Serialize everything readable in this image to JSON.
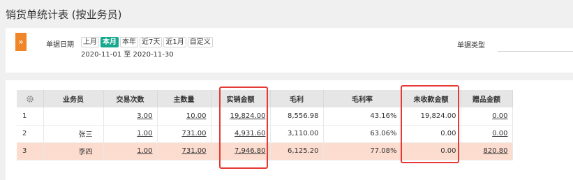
{
  "page": {
    "title": "销货单统计表 (按业务员)"
  },
  "filters": {
    "toggle_icon": "»",
    "date_label": "单据日期",
    "ranges": [
      "上月",
      "本月",
      "本年",
      "近7天",
      "近1月",
      "自定义"
    ],
    "active_range": "本月",
    "date_from": "2020-11-01",
    "date_sep": "至",
    "date_to": "2020-11-30",
    "doctype_label": "单据类型",
    "doctype_value": ""
  },
  "table": {
    "columns": [
      "",
      "业务员",
      "交易次数",
      "主数量",
      "实销金额",
      "毛利",
      "毛利率",
      "未收款金额",
      "赠品金额"
    ],
    "rows": [
      {
        "idx": "1",
        "name": "",
        "count": "3.00",
        "qty": "10.00",
        "sales": "19,824.00",
        "profit": "8,556.98",
        "margin": "43.16%",
        "unpaid": "19,824.00",
        "gift": "0.00"
      },
      {
        "idx": "2",
        "name": "张三",
        "count": "1.00",
        "qty": "731.00",
        "sales": "4,931.60",
        "profit": "3,110.00",
        "margin": "63.06%",
        "unpaid": "0.00",
        "gift": "0.00"
      },
      {
        "idx": "3",
        "name": "李四",
        "count": "1.00",
        "qty": "731.00",
        "sales": "7,946.80",
        "profit": "6,125.20",
        "margin": "77.08%",
        "unpaid": "0.00",
        "gift": "820.80"
      }
    ]
  },
  "colors": {
    "accent": "#18a88e",
    "toggle": "#f0862a",
    "highlight_box": "#e53935",
    "selected_row": "#fcdccf",
    "header_bg": "#e6e6e6"
  }
}
